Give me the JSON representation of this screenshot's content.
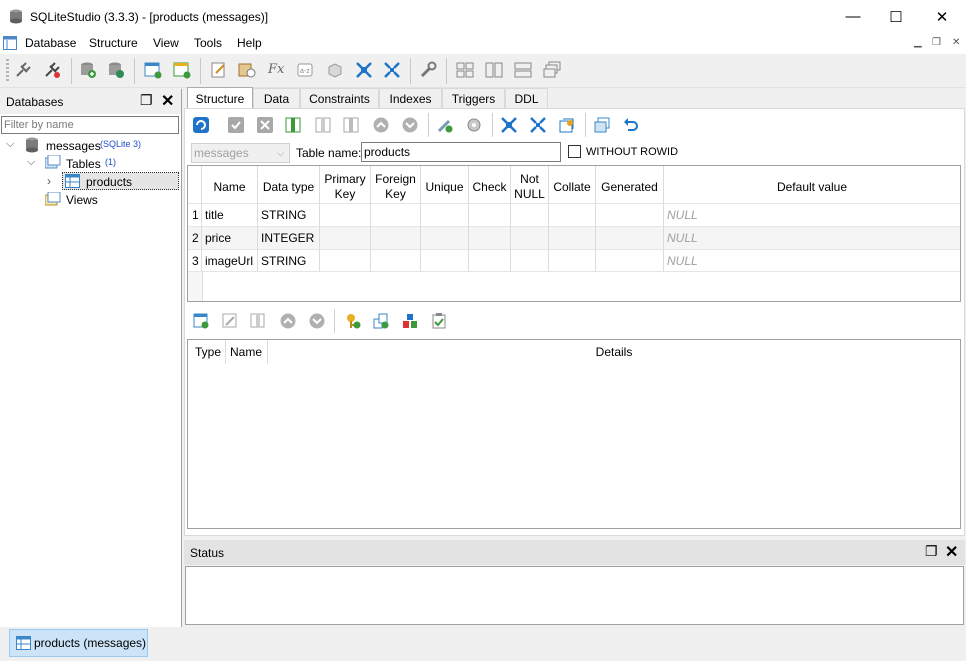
{
  "window": {
    "title": "SQLiteStudio (3.3.3) - [products (messages)]"
  },
  "menu": {
    "items": [
      "Database",
      "Structure",
      "View",
      "Tools",
      "Help"
    ]
  },
  "databases_panel": {
    "title": "Databases",
    "filter_placeholder": "Filter by name",
    "tree": {
      "database": "messages",
      "database_type": "(SQLite 3)",
      "tables_label": "Tables",
      "tables_count": "(1)",
      "table": "products",
      "views_label": "Views"
    }
  },
  "tabs": [
    "Structure",
    "Data",
    "Constraints",
    "Indexes",
    "Triggers",
    "DDL"
  ],
  "structure": {
    "database_select": "messages",
    "table_name_label": "Table name:",
    "table_name": "products",
    "without_rowid_label": "WITHOUT ROWID",
    "without_rowid_checked": false,
    "columns_headers": [
      "Name",
      "Data type",
      "Primary Key",
      "Foreign Key",
      "Unique",
      "Check",
      "Not NULL",
      "Collate",
      "Generated",
      "Default value"
    ],
    "rows": [
      {
        "num": "1",
        "name": "title",
        "type": "STRING",
        "default": "NULL"
      },
      {
        "num": "2",
        "name": "price",
        "type": "INTEGER",
        "default": "NULL"
      },
      {
        "num": "3",
        "name": "imageUrl",
        "type": "STRING",
        "default": "NULL"
      }
    ],
    "constraints_headers": [
      "Type",
      "Name",
      "Details"
    ]
  },
  "status": {
    "title": "Status"
  },
  "taskbar": {
    "window_button": "products (messages)"
  },
  "colors": {
    "accent": "#1e74c8",
    "selected": "#cce4f7"
  }
}
